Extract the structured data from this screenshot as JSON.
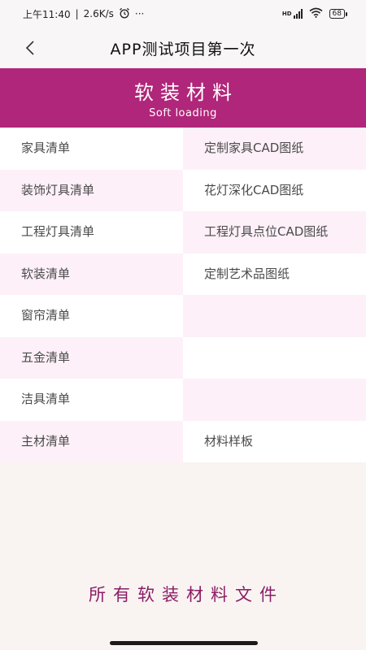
{
  "status_bar": {
    "time": "上午11:40",
    "separator": "|",
    "speed": "2.6K/s",
    "dots": "···",
    "hd_label": "HD",
    "battery": "68"
  },
  "nav": {
    "title": "APP测试项目第一次"
  },
  "banner": {
    "title": "软装材料",
    "subtitle": "Soft loading",
    "color": "#b0267a"
  },
  "grid": {
    "left": [
      "家具清单",
      "装饰灯具清单",
      "工程灯具清单",
      "软装清单",
      "窗帘清单",
      "五金清单",
      "洁具清单",
      "主材清单"
    ],
    "right": [
      "定制家具CAD图纸",
      "花灯深化CAD图纸",
      "工程灯具点位CAD图纸",
      "定制艺术品图纸",
      "",
      "",
      "",
      "材料样板"
    ]
  },
  "footer": {
    "text": "所有软装材料文件"
  }
}
